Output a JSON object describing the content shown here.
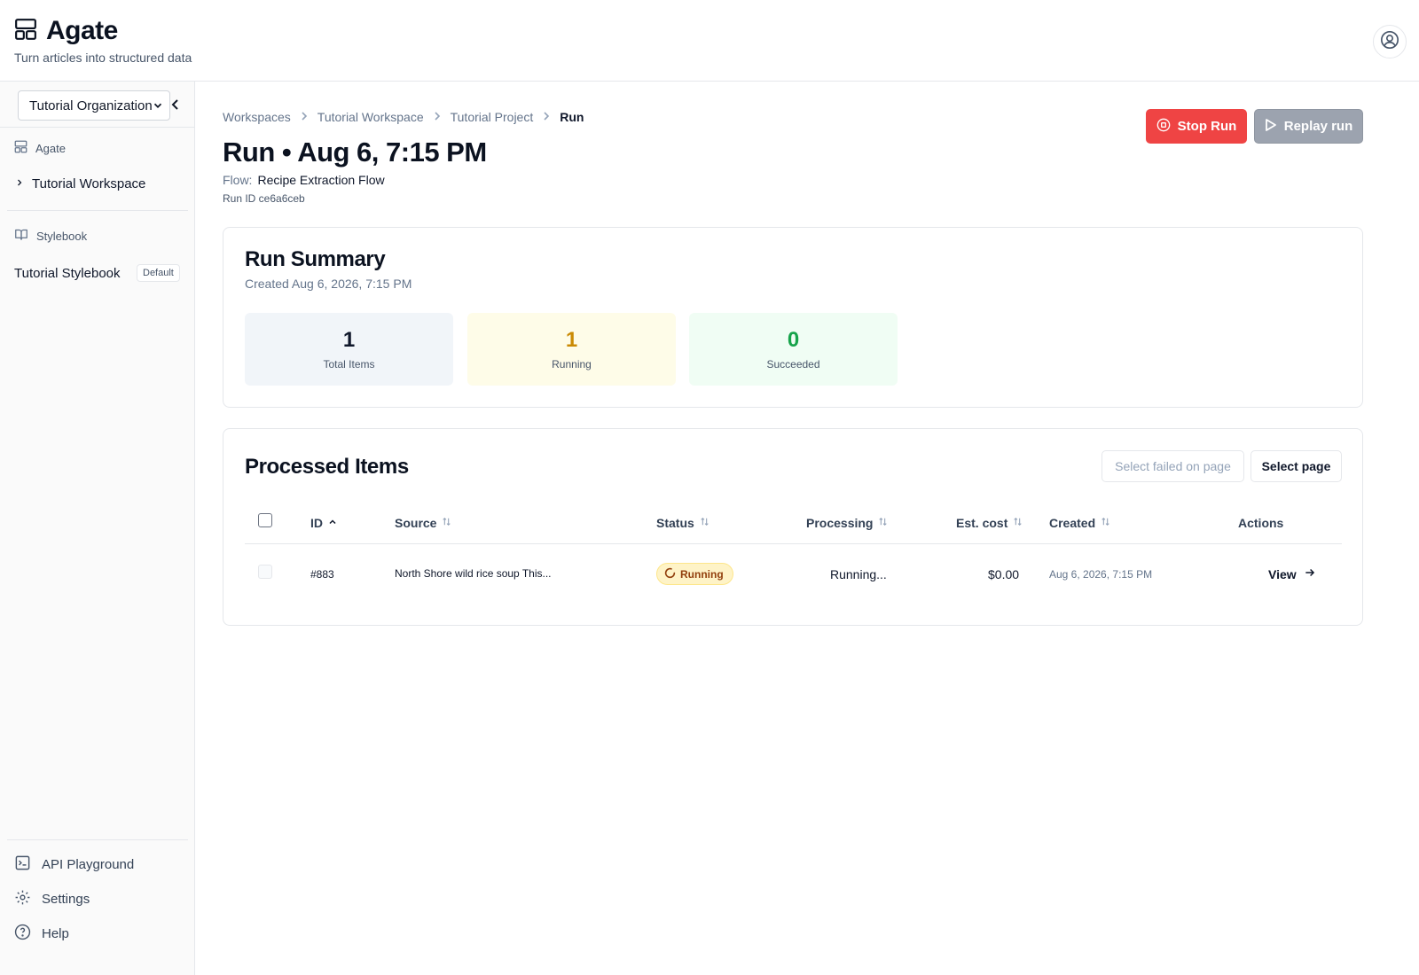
{
  "app": {
    "name": "Agate",
    "tagline": "Turn articles into structured data"
  },
  "sidebar": {
    "org_selected": "Tutorial Organization",
    "section_agate": "Agate",
    "workspace_item": "Tutorial Workspace",
    "section_stylebook": "Stylebook",
    "stylebook_item": "Tutorial Stylebook",
    "stylebook_badge": "Default",
    "bottom": {
      "api": "API Playground",
      "settings": "Settings",
      "help": "Help"
    }
  },
  "breadcrumb": [
    "Workspaces",
    "Tutorial Workspace",
    "Tutorial Project",
    "Run"
  ],
  "run": {
    "title": "Run • Aug 6, 7:15 PM",
    "flow_label": "Flow:",
    "flow_value": "Recipe Extraction Flow",
    "run_id": "Run ID ce6a6ceb"
  },
  "actions": {
    "stop": "Stop Run",
    "replay": "Replay run"
  },
  "summary": {
    "title": "Run Summary",
    "created": "Created Aug 6, 2026, 7:15 PM",
    "stats": [
      {
        "value": "1",
        "label": "Total Items",
        "color": "#0f172a",
        "bg": "#f1f5f9"
      },
      {
        "value": "1",
        "label": "Running",
        "color": "#ca8a04",
        "bg": "#fefce8"
      },
      {
        "value": "0",
        "label": "Succeeded",
        "color": "#16a34a",
        "bg": "#f0fdf4"
      }
    ]
  },
  "items": {
    "title": "Processed Items",
    "select_failed": "Select failed on page",
    "select_page": "Select page",
    "columns": [
      "ID",
      "Source",
      "Status",
      "Processing",
      "Est. cost",
      "Created",
      "Actions"
    ],
    "rows": [
      {
        "id": "#883",
        "source": "North Shore wild rice soup This...",
        "status": "Running",
        "processing": "Running...",
        "cost": "$0.00",
        "created": "Aug 6, 2026, 7:15 PM",
        "action": "View"
      }
    ]
  }
}
